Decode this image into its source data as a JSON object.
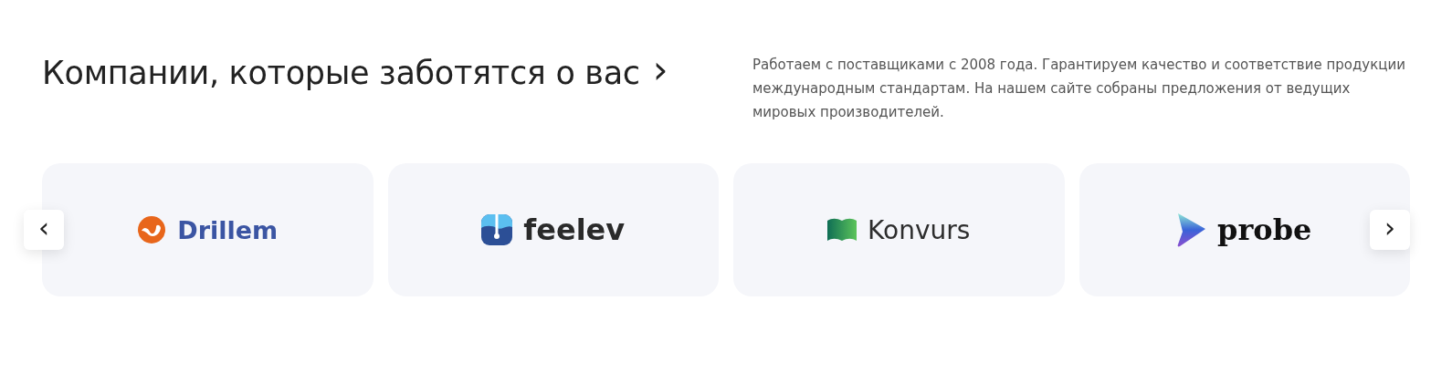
{
  "heading": {
    "title": "Компании, которые заботятся о вас",
    "arrow": "›"
  },
  "description": "Работаем с поставщиками с 2008 года. Гарантируем качество и соответствие продукции международным стандартам. На нашем сайте собраны предложения от ведущих мировых производителей.",
  "carousel": {
    "prev": "‹",
    "next": "›",
    "brands": [
      {
        "kind": "drillem",
        "name": "Drillem"
      },
      {
        "kind": "feelev",
        "name": "feelev"
      },
      {
        "kind": "konvurs",
        "name": "Konvurs"
      },
      {
        "kind": "probe",
        "name": "probe"
      }
    ]
  }
}
